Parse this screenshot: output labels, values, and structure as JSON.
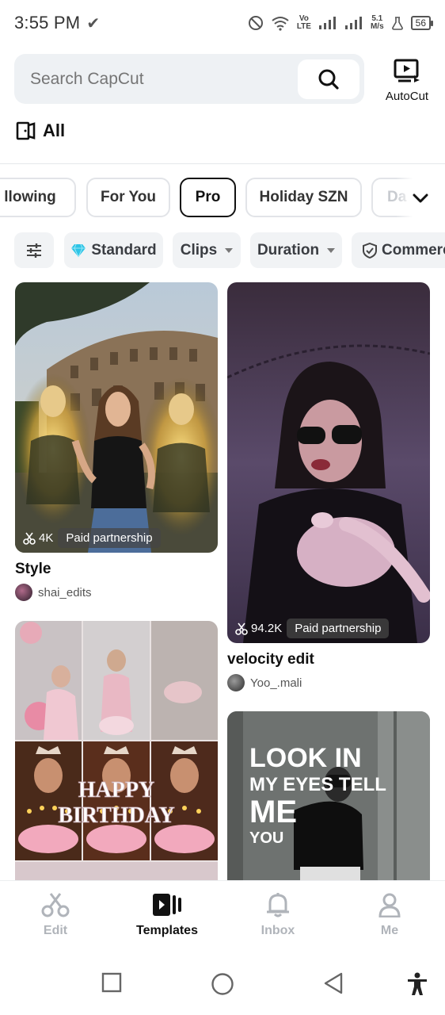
{
  "status_bar": {
    "time": "3:55 PM",
    "net_type_top": "Vo",
    "net_type_bottom": "LTE",
    "speed_value": "5.1",
    "speed_unit": "M/s",
    "battery": "56",
    "icons": [
      "check-icon",
      "do-not-disturb-icon",
      "wifi-icon",
      "signal-icon",
      "signal-icon",
      "alarm-icon",
      "battery-icon"
    ]
  },
  "search": {
    "placeholder": "Search CapCut"
  },
  "autocut": {
    "label": "AutoCut"
  },
  "all_row": {
    "label": "All"
  },
  "categories": [
    {
      "label": "llowing"
    },
    {
      "label": "For You"
    },
    {
      "label": "Pro",
      "active": true
    },
    {
      "label": "Holiday SZN"
    },
    {
      "label": "Da"
    }
  ],
  "filters": [
    {
      "label": "Standard"
    },
    {
      "label": "Clips"
    },
    {
      "label": "Duration"
    },
    {
      "label": "Commerc"
    }
  ],
  "cards": [
    {
      "title": "Style",
      "author": "shai_edits",
      "uses": "4K",
      "badge": "Paid partnership"
    },
    {
      "title": "velocity edit",
      "author": "Yoo_.mali",
      "uses": "94.2K",
      "badge": "Paid partnership"
    },
    {
      "image_text_1": "HAPPY",
      "image_text_2": "BIRTHDAY"
    },
    {
      "image_text_1": "LOOK IN",
      "image_text_2": "MY EYES TELL",
      "image_text_3": "ME",
      "image_text_4": "YOU"
    }
  ],
  "bottom_nav": [
    {
      "label": "Edit"
    },
    {
      "label": "Templates",
      "active": true
    },
    {
      "label": "Inbox"
    },
    {
      "label": "Me"
    }
  ],
  "colors": {
    "accent": "#111111",
    "chip_border": "#e2e4e8",
    "filter_bg": "#f1f3f5",
    "inactive_nav": "#b0b4ba",
    "diamond": "#2ec4e6"
  }
}
